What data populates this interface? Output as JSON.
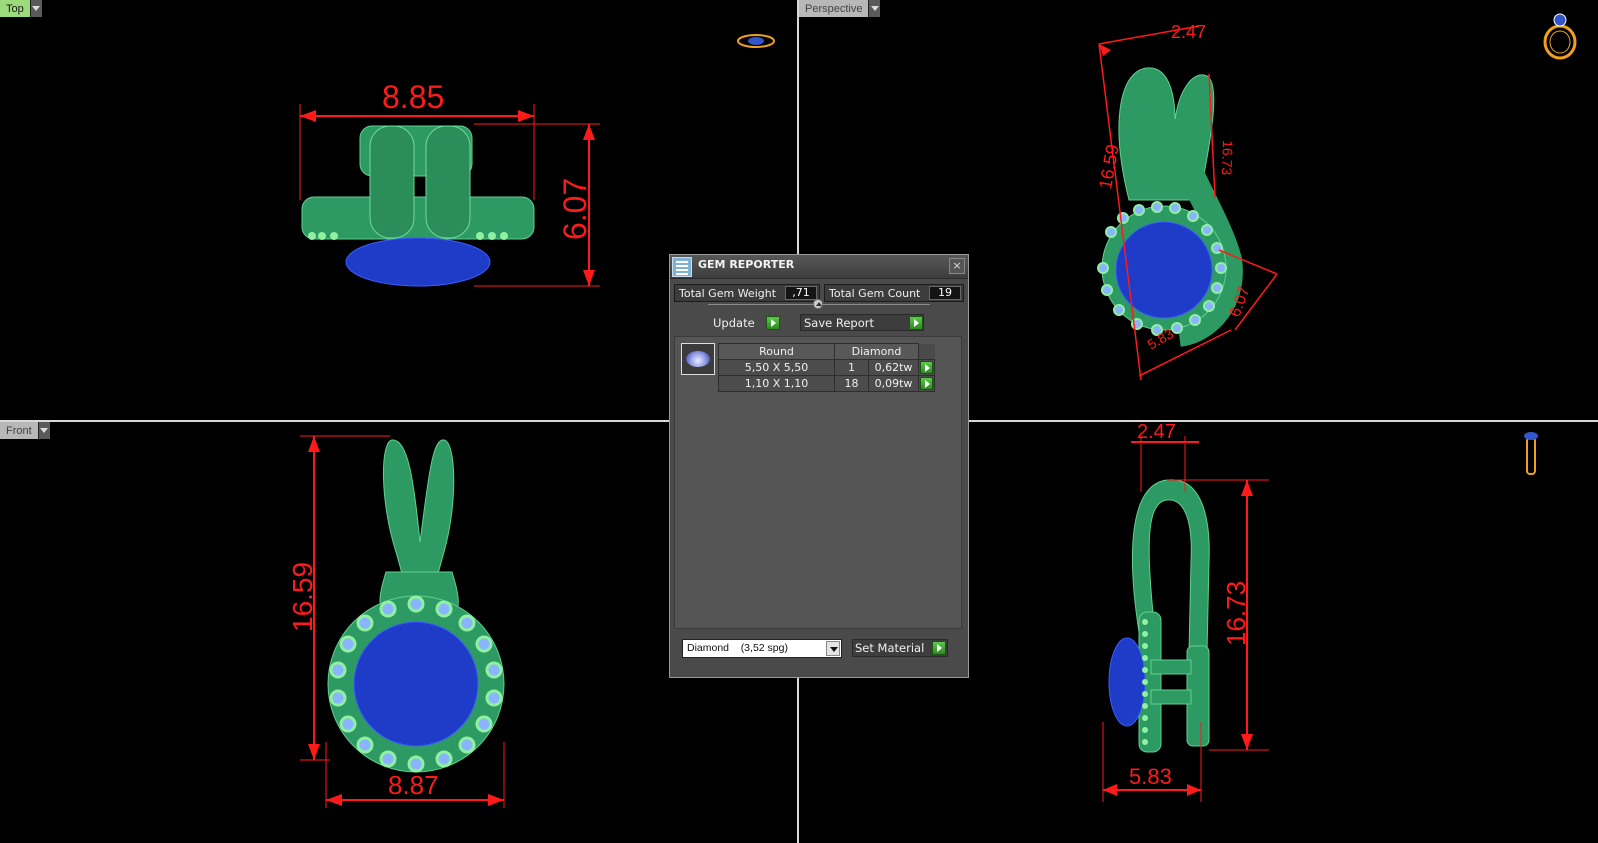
{
  "viewports": {
    "top": {
      "label": "Top"
    },
    "perspective": {
      "label": "Perspective"
    },
    "front": {
      "label": "Front"
    }
  },
  "dimensions": {
    "top_width": "8.85",
    "top_height": "6.07",
    "persp_top": "2.47",
    "persp_left": "16.59",
    "persp_right": "16.73",
    "persp_depth": "6.07",
    "persp_base": "5.83",
    "front_height": "16.59",
    "front_width": "8.87",
    "side_top": "2.47",
    "side_height": "16.73",
    "side_width": "5.83"
  },
  "gem_reporter": {
    "title": "GEM REPORTER",
    "close": "×",
    "total_weight_label": "Total Gem Weight",
    "total_weight_value": ",71",
    "total_count_label": "Total Gem Count",
    "total_count_value": "19",
    "update_label": "Update",
    "save_report_label": "Save Report",
    "table": {
      "header_shape": "Round",
      "header_material": "Diamond",
      "rows": [
        {
          "size": "5,50 X 5,50",
          "count": "1",
          "weight": "0,62tw"
        },
        {
          "size": "1,10 X 1,10",
          "count": "18",
          "weight": "0,09tw"
        }
      ]
    },
    "material_select": "Diamond    (3,52 spg)",
    "set_material_label": "Set Material"
  },
  "colors": {
    "metal": "#2e9a63",
    "center_stone": "#1e3cc8",
    "accent_stones": "#7fb3ff",
    "dimension": "#ff1a1a",
    "viewport_tab_active": "#9bdb7c"
  },
  "icons": {
    "top_gizmo": "ring-top-icon",
    "persp_gizmo": "ring-perspective-icon",
    "side_gizmo": "pendant-side-icon"
  }
}
